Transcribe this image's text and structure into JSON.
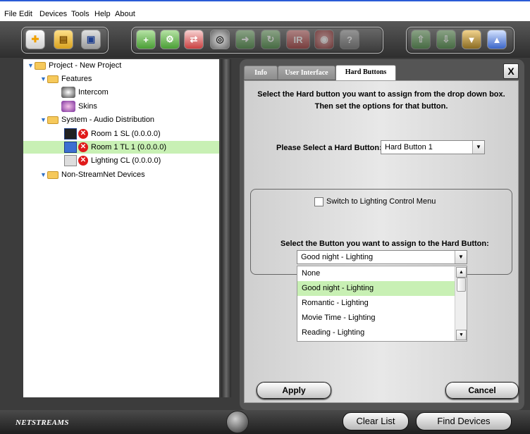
{
  "menu": [
    "File",
    "Edit",
    "Devices",
    "Tools",
    "Help",
    "About"
  ],
  "toolbar": {
    "ir_label": "IR",
    "help_label": "?"
  },
  "tree": {
    "project": "Project - New Project",
    "features": "Features",
    "intercom": "Intercom",
    "skins": "Skins",
    "system": "System - Audio Distribution",
    "room_sl": "Room 1 SL (0.0.0.0)",
    "room_tl": "Room 1 TL 1 (0.0.0.0)",
    "lighting_cl": "Lighting CL (0.0.0.0)",
    "non_streamnet": "Non-StreamNet Devices"
  },
  "tabs": [
    "Info",
    "User Interface",
    "Hard Buttons"
  ],
  "close_label": "X",
  "instructions": {
    "line1": "Select the Hard button you want to assign from the drop down box.",
    "line2": "Then set the options for that button."
  },
  "hard_button": {
    "label": "Please Select a Hard Button:",
    "value": "Hard Button 1"
  },
  "switch_label": "Switch to Lighting Control Menu",
  "assign": {
    "label": "Select the Button you want to assign to the Hard Button:",
    "value": "Good night - Lighting",
    "options": [
      "None",
      "Good night - Lighting",
      "Romantic - Lighting",
      "Movie Time - Lighting",
      "Reading - Lighting"
    ]
  },
  "apply_label": "Apply",
  "cancel_label": "Cancel",
  "footer": {
    "logo": "NETSTREAMS",
    "clear_list": "Clear List",
    "find_devices": "Find Devices"
  },
  "colors": {
    "selection": "#c8f0b4",
    "menubar_border": "#2a5bd6",
    "error_badge": "#e01a1a"
  }
}
